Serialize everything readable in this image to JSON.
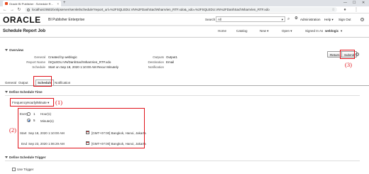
{
  "browser": {
    "tab_title": "Oracle BI Publisher : Schedule R...",
    "tab_close": "×",
    "new_tab": "+",
    "minimize": "—",
    "maximize": "☐",
    "close": "✕",
    "url": "localhost:9502/xmlpserver/servlet/schedule?report_url=%2FSQLEDU.VN%2FDanhSachNhanVien_RTF.xdo&_xdo=%2FSQLEDU.VN%2FDanhSachNhanVien_RTF.xdo"
  },
  "header": {
    "brand": "ORACLE",
    "product": "BI Publisher Enterprise",
    "search_label": "Search",
    "search_scope": "All",
    "administration": "Administration",
    "help": "Help",
    "sign_out": "Sign Out",
    "help_icon": "?"
  },
  "subbar": {
    "page_title": "Schedule Report Job",
    "nav": {
      "home": "Home",
      "catalog": "Catalog",
      "new": "New",
      "open": "Open",
      "signed_in_label": "Signed In As",
      "user": "weblogic"
    }
  },
  "overview": {
    "heading": "Overview",
    "general_label": "General",
    "general_value": "Created by weblogic",
    "report_name_label": "Report Name",
    "report_name_value": "/SQLEDU.VN/DanhSachNhanVien_RTF.xdo",
    "schedule_label": "Schedule",
    "schedule_value": "Start on Sep 18, 2020 1:10:00 AM Recur Minutely",
    "outputs_label": "Outputs",
    "outputs_value": "Output1",
    "destination_label": "Destination",
    "destination_value": "Email",
    "notification_label": "Notification"
  },
  "actions": {
    "return": "Return",
    "submit": "Submit",
    "annot_submit": "(3)"
  },
  "tabs": [
    "General",
    "Output",
    "Schedule",
    "Notification"
  ],
  "schedule": {
    "section_title": "Define Schedule Time",
    "frequency_label": "Frequency",
    "frequency_value": "Hourly/Minute",
    "annot_frequency": "(1)",
    "every_label": "Every",
    "hours_value": "1",
    "hours_unit": "Hour(s)",
    "minutes_value": "5",
    "minutes_unit": "Minute(s)",
    "annot_range": "(2)",
    "start_label": "Start",
    "start_value": "Sep 18, 2020 1:10:00 AM",
    "start_tz": "[GMT+07:00] Bangkok, Hanoi, Jakarta",
    "end_label": "End",
    "end_value": "Sep 23, 2020 1:06:29 AM",
    "end_tz": "[GMT+07:00] Bangkok, Hanoi, Jakarta"
  },
  "trigger": {
    "section_title": "Define Schedule Trigger",
    "use_trigger": "Use Trigger"
  },
  "colors": {
    "annotation_red": "#e0121a",
    "radio_blue": "#2a6ac8"
  }
}
